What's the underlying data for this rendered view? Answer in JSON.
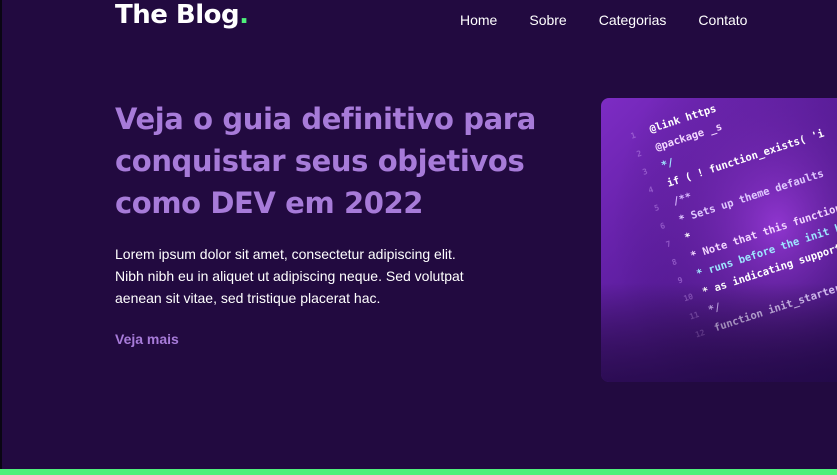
{
  "header": {
    "brand": "The Blog",
    "brand_dot": ".",
    "nav": [
      "Home",
      "Sobre",
      "Categorias",
      "Contato"
    ]
  },
  "hero": {
    "title_lines": [
      "Veja o guia definitivo para",
      "conquistar seus objetivos",
      "como DEV em 2022"
    ],
    "text_lines": [
      "Lorem ipsum dolor sit amet, consectetur adipiscing elit.",
      "Nibh nibh eu in aliquet ut adipiscing neque. Sed volutpat",
      "aenean sit vitae, sed tristique placerat hac."
    ],
    "link": "Veja mais",
    "image": {
      "code_lines": [
        "@link https",
        "@package _s",
        "*/",
        "if ( ! function_exists( 'i",
        "/**",
        " * Sets up theme defaults",
        " *",
        " * Note that this function",
        " * runs before the init ho",
        " * as indicating support",
        " */",
        "function init_starter_"
      ]
    }
  },
  "colors": {
    "background": "#220a40",
    "accent": "#4ef07a",
    "title": "#a77bd9"
  }
}
